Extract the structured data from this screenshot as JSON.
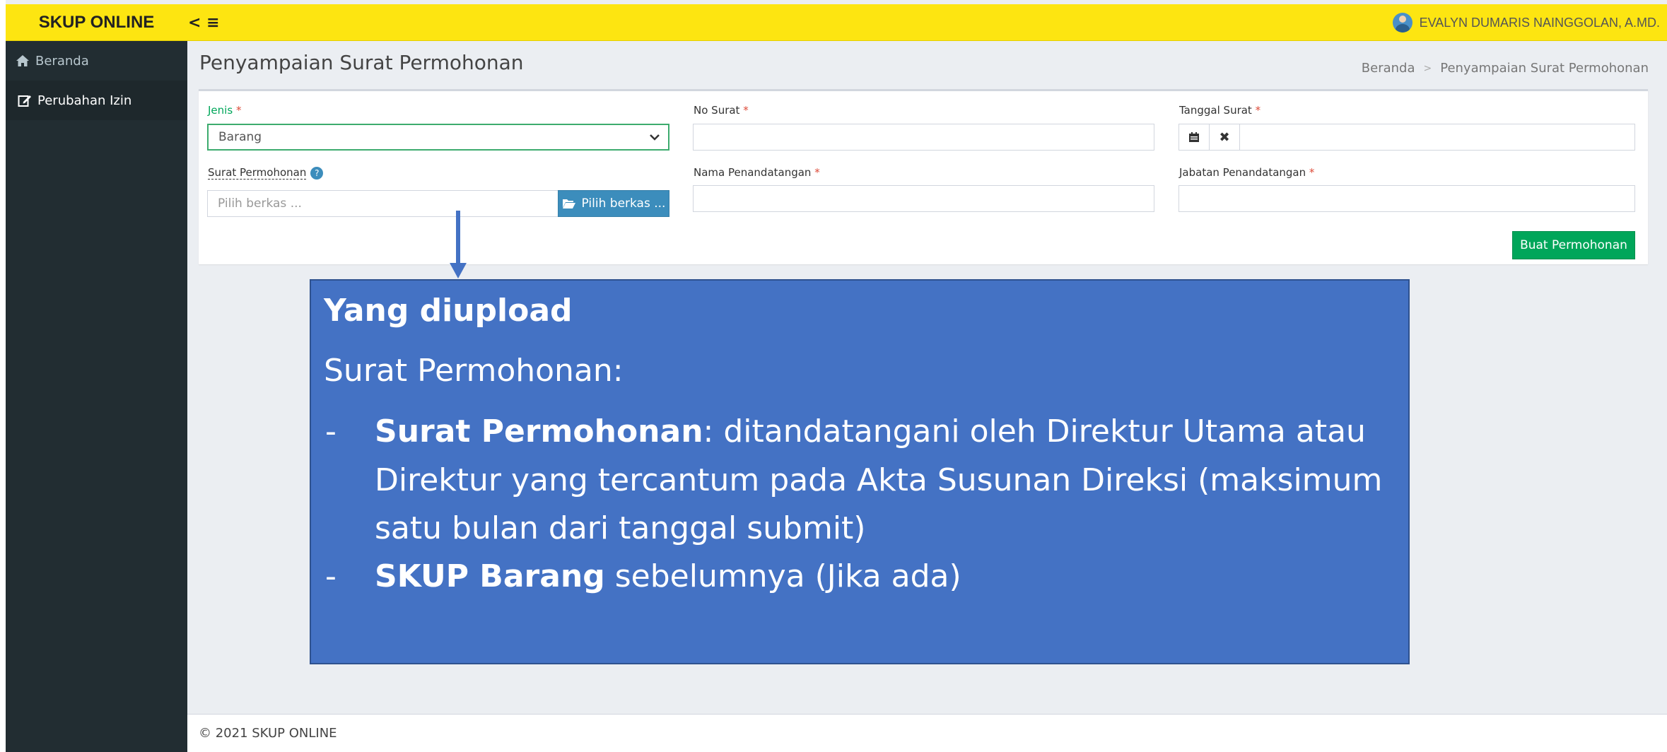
{
  "app": {
    "brand": "SKUP ONLINE",
    "nav_toggle": "< ≡"
  },
  "user": {
    "name": "EVALYN DUMARIS NAINGGOLAN, A.MD."
  },
  "sidebar": {
    "items": [
      {
        "label": "Beranda",
        "icon": "home-icon"
      },
      {
        "label": "Perubahan Izin",
        "icon": "edit-icon"
      }
    ]
  },
  "page": {
    "title": "Penyampaian Surat Permohonan",
    "breadcrumb": [
      "Beranda",
      "Penyampaian Surat Permohonan"
    ]
  },
  "form": {
    "jenis": {
      "label": "Jenis",
      "value": "Barang"
    },
    "no_surat": {
      "label": "No Surat",
      "value": ""
    },
    "tanggal_surat": {
      "label": "Tanggal Surat",
      "value": ""
    },
    "surat_permohonan": {
      "label": "Surat Permohonan",
      "placeholder": "Pilih berkas ...",
      "button": "Pilih berkas ..."
    },
    "nama_penandatangan": {
      "label": "Nama Penandatangan",
      "value": ""
    },
    "jabatan_penandatangan": {
      "label": "Jabatan Penandatangan",
      "value": ""
    },
    "submit": "Buat Permohonan",
    "required_mark": "*"
  },
  "callout": {
    "title": "Yang diupload",
    "subtitle": "Surat Permohonan:",
    "items": [
      {
        "bold": "Surat Permohonan",
        "text": ": ditandatangani oleh Direktur Utama atau Direktur yang tercantum pada Akta Susunan Direksi (maksimum satu bulan dari tanggal submit)"
      },
      {
        "bold": "SKUP Barang",
        "text": " sebelumnya (Jika ada)"
      }
    ]
  },
  "footer": {
    "text": "© 2021 SKUP ONLINE"
  },
  "colors": {
    "header": "#fde511",
    "sidebar": "#222d32",
    "callout": "#4472c4",
    "submit": "#00a65a",
    "browse": "#3c8dbc"
  }
}
